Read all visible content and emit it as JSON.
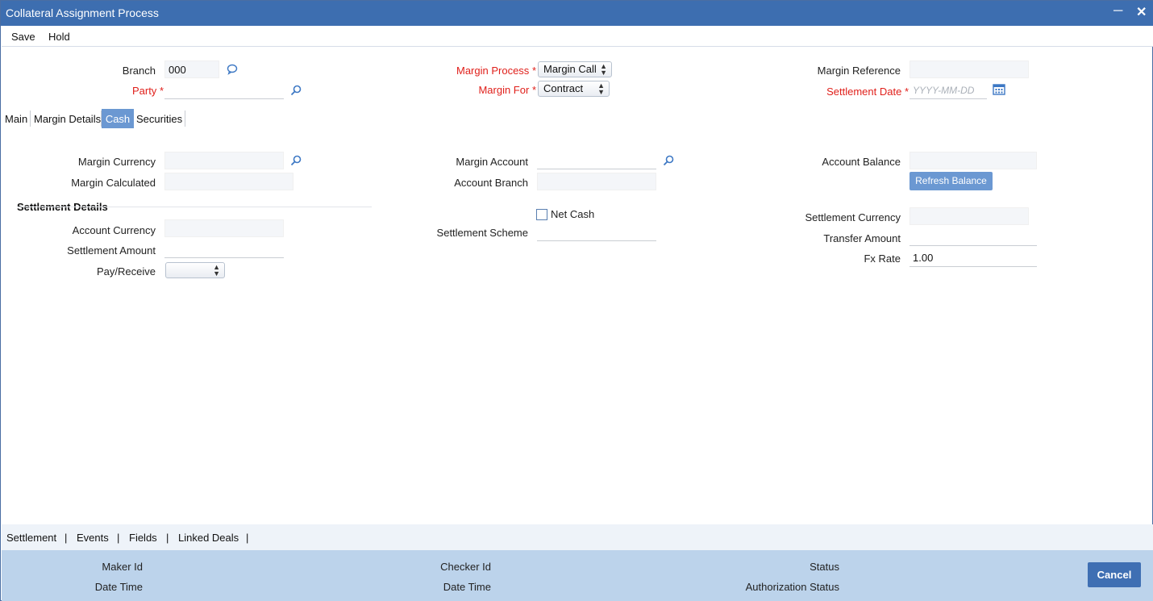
{
  "window": {
    "title": "Collateral Assignment Process",
    "minimize_icon": "minimize-icon",
    "close_icon": "close-icon"
  },
  "menu": {
    "save": "Save",
    "hold": "Hold"
  },
  "header": {
    "branch_label": "Branch",
    "branch_value": "000",
    "party_label": "Party",
    "required_mark": "*",
    "margin_process_label": "Margin Process",
    "margin_process_value": "Margin Call",
    "margin_for_label": "Margin For",
    "margin_for_value": "Contract",
    "margin_reference_label": "Margin Reference",
    "settlement_date_label": "Settlement Date",
    "settlement_date_placeholder": "YYYY-MM-DD"
  },
  "tabs": [
    {
      "label": "Main",
      "active": false
    },
    {
      "label": "Margin Details",
      "active": false
    },
    {
      "label": "Cash",
      "active": true
    },
    {
      "label": "Securities",
      "active": false
    }
  ],
  "cash": {
    "margin_currency_label": "Margin Currency",
    "margin_calculated_label": "Margin Calculated",
    "margin_account_label": "Margin Account",
    "account_branch_label": "Account Branch",
    "account_balance_label": "Account Balance",
    "refresh_balance_label": "Refresh Balance",
    "settlement_details_title": "Settlement Details",
    "account_currency_label": "Account Currency",
    "settlement_amount_label": "Settlement Amount",
    "pay_receive_label": "Pay/Receive",
    "net_cash_label": "Net Cash",
    "settlement_scheme_label": "Settlement Scheme",
    "settlement_currency_label": "Settlement Currency",
    "transfer_amount_label": "Transfer Amount",
    "fx_rate_label": "Fx Rate",
    "fx_rate_value": "1.00"
  },
  "footer_links": {
    "settlement": "Settlement",
    "events": "Events",
    "fields": "Fields",
    "linked_deals": "Linked Deals",
    "separator": "|"
  },
  "footer_info": {
    "maker_id_label": "Maker Id",
    "maker_date_time_label": "Date Time",
    "checker_id_label": "Checker Id",
    "checker_date_time_label": "Date Time",
    "status_label": "Status",
    "authorization_status_label": "Authorization Status",
    "cancel_label": "Cancel"
  },
  "colors": {
    "title_bar": "#3d6eb0",
    "active_tab": "#6b98d2",
    "required": "#e0201b",
    "footer": "#bcd3eb",
    "cancel_button": "#3f6fb3"
  }
}
